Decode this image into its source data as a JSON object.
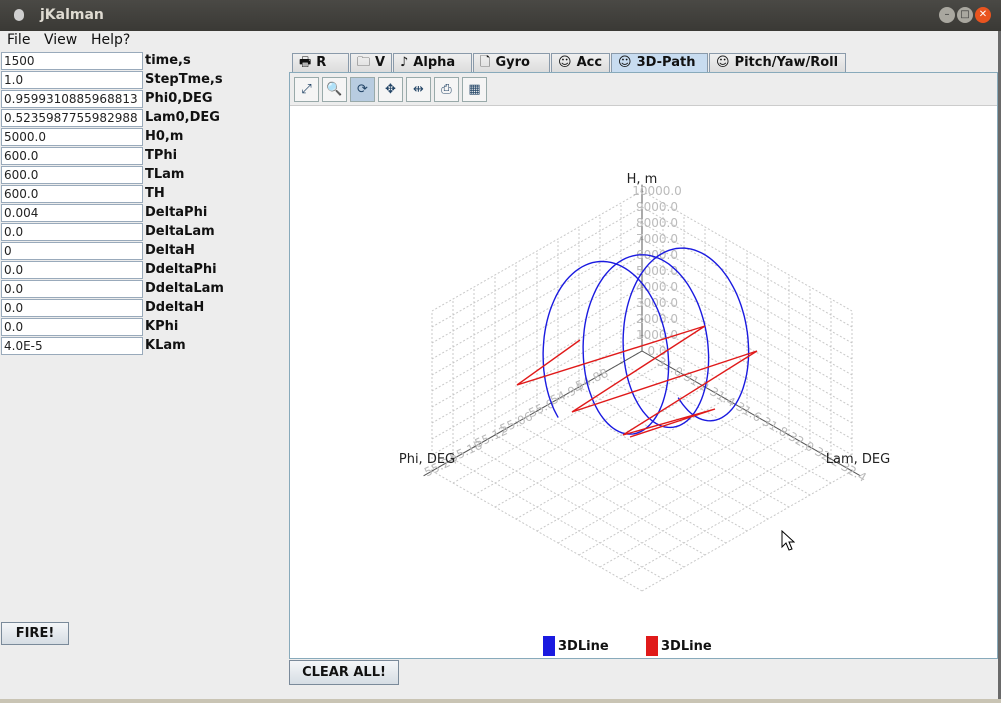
{
  "window": {
    "title": "jKalman"
  },
  "menu": [
    "File",
    "View",
    "Help?"
  ],
  "params": [
    {
      "value": "1500",
      "label": "time,s"
    },
    {
      "value": "1.0",
      "label": "StepTme,s"
    },
    {
      "value": "0.9599310885968813",
      "label": "Phi0,DEG"
    },
    {
      "value": "0.5235987755982988",
      "label": "Lam0,DEG"
    },
    {
      "value": "5000.0",
      "label": "H0,m"
    },
    {
      "value": "600.0",
      "label": "TPhi"
    },
    {
      "value": "600.0",
      "label": "TLam"
    },
    {
      "value": "600.0",
      "label": "TH"
    },
    {
      "value": "0.004",
      "label": "DeltaPhi"
    },
    {
      "value": "0.0",
      "label": "DeltaLam"
    },
    {
      "value": "0",
      "label": "DeltaH"
    },
    {
      "value": "0.0",
      "label": "DdeltaPhi"
    },
    {
      "value": "0.0",
      "label": "DdeltaLam"
    },
    {
      "value": "0.0",
      "label": "DdeltaH"
    },
    {
      "value": "0.0",
      "label": "KPhi"
    },
    {
      "value": "4.0E-5",
      "label": "KLam"
    }
  ],
  "buttons": {
    "fire": "FIRE!",
    "clear": "CLEAR ALL!"
  },
  "tabs": [
    {
      "label": "R",
      "icon": "printer-icon",
      "glyph": "🖶"
    },
    {
      "label": "V",
      "icon": "folder-icon",
      "glyph": "🗀"
    },
    {
      "label": "Alpha",
      "icon": "music-note-icon",
      "glyph": "♪"
    },
    {
      "label": "Gyro",
      "icon": "page-icon",
      "glyph": "🗋"
    },
    {
      "label": "Acc",
      "icon": "smiley-icon",
      "glyph": "☺"
    },
    {
      "label": "3D-Path",
      "icon": "smiley-icon",
      "glyph": "☺"
    },
    {
      "label": "Pitch/Yaw/Roll",
      "icon": "smiley-icon",
      "glyph": "☺"
    }
  ],
  "active_tab": "3D-Path",
  "toolbar": [
    {
      "name": "zoom-reset-icon",
      "glyph": "⤢"
    },
    {
      "name": "zoom-icon",
      "glyph": "🔍"
    },
    {
      "name": "rotate-icon",
      "glyph": "⟳"
    },
    {
      "name": "pan-icon",
      "glyph": "✥"
    },
    {
      "name": "translate-icon",
      "glyph": "⇹"
    },
    {
      "name": "export-icon",
      "glyph": "⎙"
    },
    {
      "name": "grid-icon",
      "glyph": "▦"
    }
  ],
  "chart_data": {
    "type": "line",
    "projection": "3d",
    "axis_labels": {
      "x": "Phi, DEG",
      "y": "Lam, DEG",
      "z": "H, m"
    },
    "z_ticks": [
      "10000.0",
      "9000.0",
      "8000.0",
      "7000.0",
      "6000.0",
      "5000.0",
      "4000.0",
      "3000.0",
      "2000.0",
      "1000.0",
      "0.0"
    ],
    "x_ticks": [
      "55.24",
      "55.18",
      "55.12",
      "55.06",
      "55.0",
      "54.94",
      "54.88"
    ],
    "y_ticks": [
      "32.4",
      "32.2",
      "32.0",
      "31.8",
      "31.6",
      "31.4",
      "31.2",
      "31.0"
    ],
    "grid": true,
    "series": [
      {
        "name": "3DLine",
        "color": "#1a1ae0"
      },
      {
        "name": "3DLine",
        "color": "#e01a1a"
      }
    ],
    "legend_position": "bottom"
  }
}
